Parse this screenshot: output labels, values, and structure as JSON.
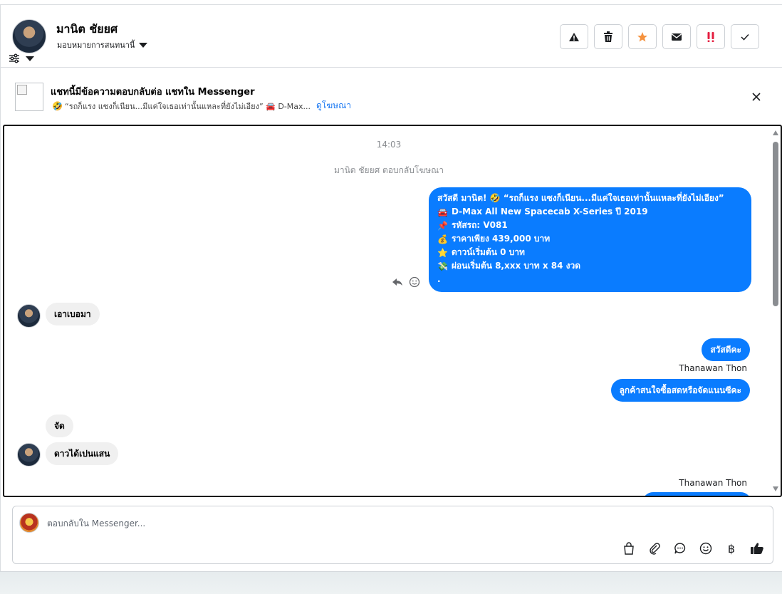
{
  "header": {
    "user_name": "มานิต ชัยยศ",
    "assign_label": "มอบหมายการสนทนานี้",
    "actions": [
      {
        "name": "report-icon",
        "color": "#1c1e21"
      },
      {
        "name": "trash-icon",
        "color": "#1c1e21"
      },
      {
        "name": "star-icon",
        "color": "#f5923e"
      },
      {
        "name": "envelope-icon",
        "color": "#1c1e21"
      },
      {
        "name": "urgent-icon",
        "color": "#e41e3f"
      },
      {
        "name": "checkmark-icon",
        "color": "#1c1e21"
      }
    ]
  },
  "ad_banner": {
    "title": "แชทนี้มีข้อความตอบกลับต่อ แชทใน Messenger",
    "subtitle": "“รถก็แรง แซงก็เนียน...มีแค่ใจเธอเท่านั้นแหละที่ยังไม่เอียง” 🚘 D-Max...",
    "link": "ดูโฆษณา"
  },
  "chat": {
    "timestamp": "14:03",
    "system_message": "มานิต ชัยยศ ตอบกลับโฆษณา",
    "ad_message_lines": [
      {
        "emoji": "🤣",
        "text": "สวัสดี มานิต! 🤣 “รถก็แรง แซงก็เนียน...มีแค่ใจเธอเท่านั้นแหละที่ยังไม่เอียง”",
        "lead": false
      },
      {
        "emoji": "🚘",
        "text": "D-Max All New Spacecab X-Series ปี 2019",
        "lead": true
      },
      {
        "emoji": "📌",
        "text": "รหัสรถ: V081",
        "lead": true
      },
      {
        "emoji": "💰",
        "text": "ราคาเพียง 439,000 บาท",
        "lead": true
      },
      {
        "emoji": "⭐",
        "text": "ดาวน์เริ่มต้น 0 บาท",
        "lead": true
      },
      {
        "emoji": "💸",
        "text": "ผ่อนเริ่มต้น 8,xxx บาท x 84 งวด",
        "lead": true
      },
      {
        "emoji": "",
        "text": ".",
        "lead": false
      }
    ],
    "customer_msg_1": "เอาเบอมา",
    "agent_reply_1": "สวัสดีคะ",
    "agent_name_1": "Thanawan Thon",
    "agent_reply_2": "ลูกค้าสนใจซื้อสดหรือจัดแนนซีคะ",
    "customer_msg_2": "จัด",
    "customer_msg_3": "ดาวได้เปนแสน",
    "agent_name_2": "Thanawan Thon"
  },
  "composer": {
    "placeholder": "ตอบกลับใน Messenger...",
    "currency_symbol": "฿",
    "tools": [
      "shopping-bag-icon",
      "paperclip-icon",
      "saved-reply-icon",
      "emoji-icon",
      "baht-icon",
      "thumbs-up-icon"
    ]
  },
  "colors": {
    "accent": "#0a7cff",
    "link": "#1877f2",
    "incoming_bubble": "#f0f0f0"
  }
}
